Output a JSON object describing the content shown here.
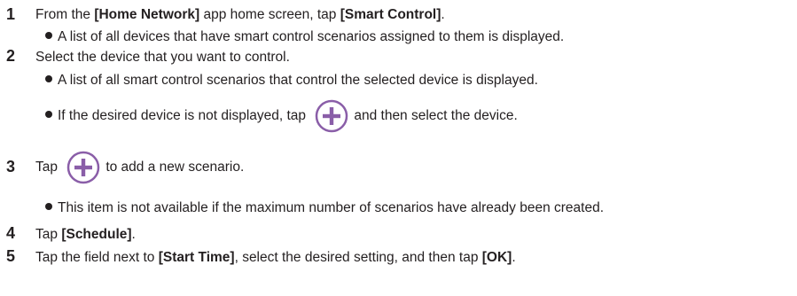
{
  "steps": [
    {
      "number": "1",
      "text_pre": "From the ",
      "app_name": "[Home Network]",
      "text_mid": " app home screen, tap ",
      "control": "[Smart Control]",
      "text_post": ".",
      "bullet": "A list of all devices that have smart control scenarios assigned to them is displayed."
    },
    {
      "number": "2",
      "text": "Select the device that you want to control.",
      "bullet1": "A list of all smart control scenarios that control the selected device is displayed.",
      "bullet2_pre": "If the desired device is not displayed, tap",
      "bullet2_post": "and then select the device."
    },
    {
      "number": "3",
      "text_pre": "Tap",
      "text_post": "to add a new scenario.",
      "bullet": "This item is not available if the maximum number of scenarios have already been created."
    },
    {
      "number": "4",
      "text_pre": "Tap ",
      "control": "[Schedule]",
      "text_post": "."
    },
    {
      "number": "5",
      "text_pre": "Tap the field next to ",
      "field": "[Start Time]",
      "text_mid": ", select the desired setting, and then tap ",
      "ok": "[OK]",
      "text_post": "."
    }
  ],
  "icons": {
    "plus": "plus-circle-icon",
    "accent_color": "#8a5ea8"
  }
}
